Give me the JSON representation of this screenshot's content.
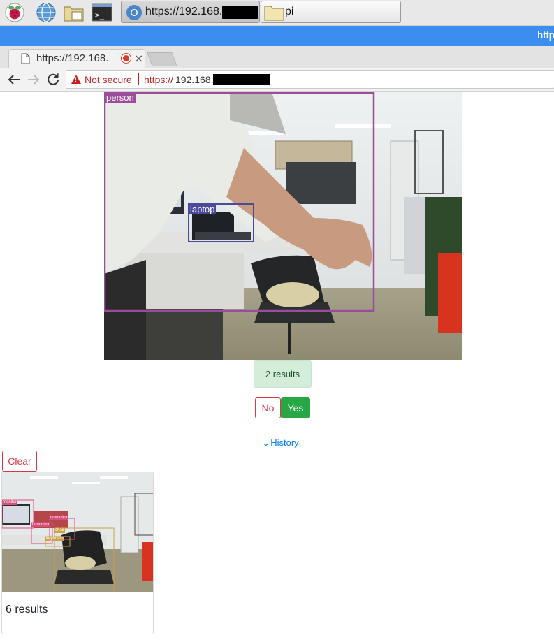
{
  "taskbar": {
    "tasks": [
      {
        "label": "https://192.168.",
        "icon": "chromium-icon"
      },
      {
        "label": "pi",
        "icon": "folder-icon"
      }
    ]
  },
  "window": {
    "title": "http"
  },
  "tab": {
    "title": "https://192.168.",
    "close": "×"
  },
  "address": {
    "security_label": "Not secure",
    "scheme": "https://",
    "host": "192.168."
  },
  "detection": {
    "labels": [
      "person",
      "laptop"
    ],
    "colors": {
      "person": "#9b4d9b",
      "laptop": "#4a4a9a"
    }
  },
  "status": {
    "results": "2 results"
  },
  "buttons": {
    "no": "No",
    "yes": "Yes",
    "clear": "Clear"
  },
  "history": {
    "label": "History"
  },
  "history_items": [
    {
      "results": "6 results",
      "labels": [
        "monitor",
        "tvmonitor",
        "tvmonitor",
        "chair",
        "keyboard"
      ]
    }
  ]
}
